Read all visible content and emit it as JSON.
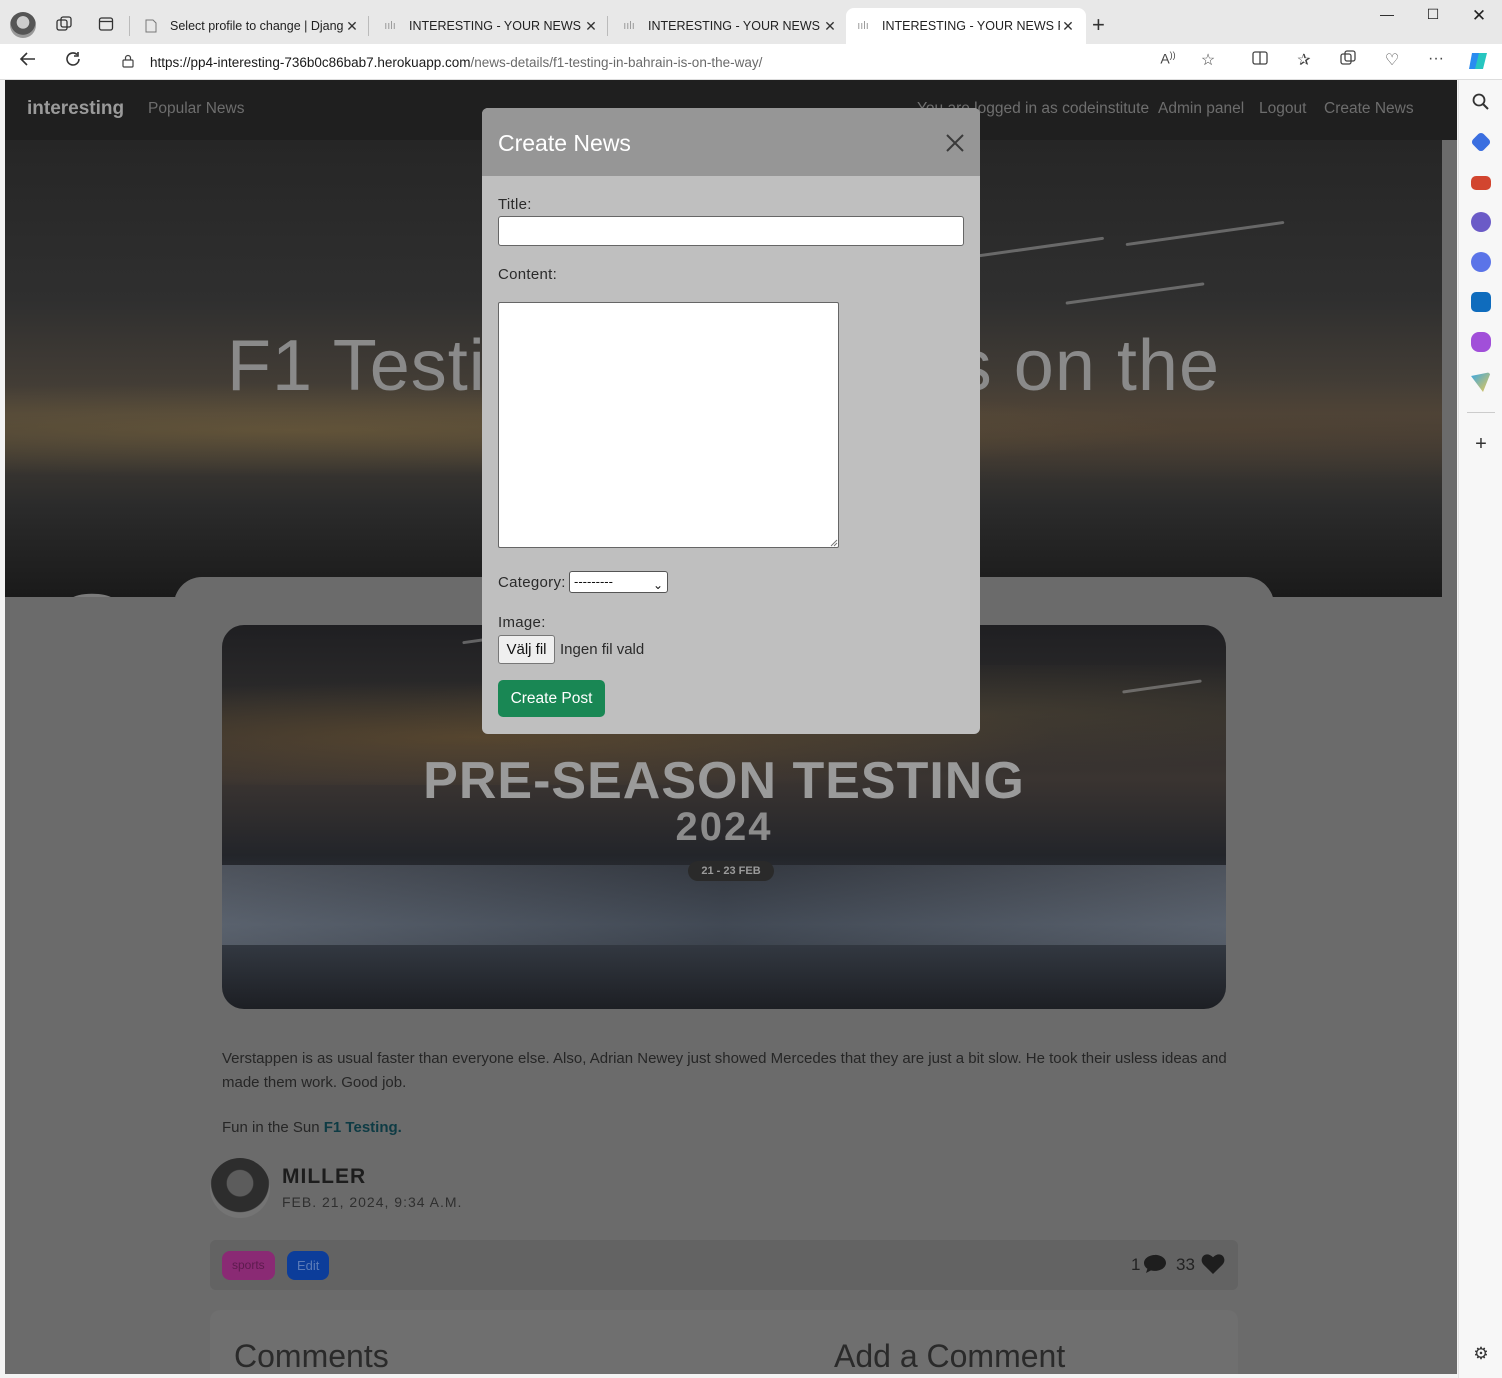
{
  "browser": {
    "tabs": [
      {
        "title": "Select profile to change | Django",
        "active": false
      },
      {
        "title": "INTERESTING - YOUR NEWS FIX",
        "active": false
      },
      {
        "title": "INTERESTING - YOUR NEWS FIX",
        "active": false
      },
      {
        "title": "INTERESTING - YOUR NEWS FIX",
        "active": true
      }
    ],
    "url_host": "https://pp4-interesting-736b0c86bab7.herokuapp.com",
    "url_path": "/news-details/f1-testing-in-bahrain-is-on-the-way/"
  },
  "site": {
    "brand": "interesting",
    "nav": {
      "popular": "Popular News",
      "user_status": "You are logged in as codeinstitute",
      "admin": "Admin panel",
      "logout": "Logout",
      "create": "Create News"
    },
    "hero": {
      "title_left": "F1 Testi",
      "title_right": "s on the",
      "big_text": "SEASON TEST"
    }
  },
  "article": {
    "image": {
      "headline": "PRE-SEASON TESTING",
      "year": "2024",
      "dates": "21 - 23 FEB"
    },
    "body": "Verstappen is as usual faster than everyone else. Also, Adrian Newey just showed Mercedes that they are just a bit slow. He took their usless ideas and made them work. Good job.",
    "footer_text": "Fun in the Sun",
    "footer_bold": "F1 Testing.",
    "author": "MILLER",
    "date": "FEB. 21, 2024, 9:34 A.M.",
    "category": "sports",
    "edit_label": "Edit",
    "comment_count": "1",
    "like_count": "33",
    "comments_heading": "Comments",
    "add_comment_heading": "Add a Comment"
  },
  "modal": {
    "title": "Create News",
    "title_label": "Title:",
    "title_value": "",
    "content_label": "Content:",
    "content_value": "",
    "category_label": "Category:",
    "category_selected": "---------",
    "image_label": "Image:",
    "file_button": "Välj fil",
    "file_status": "Ingen fil vald",
    "submit_label": "Create Post"
  },
  "colors": {
    "submit": "#198754",
    "category_badge": "#8a2a74",
    "edit_badge": "#0c3d9a",
    "modal_header": "#969696"
  }
}
